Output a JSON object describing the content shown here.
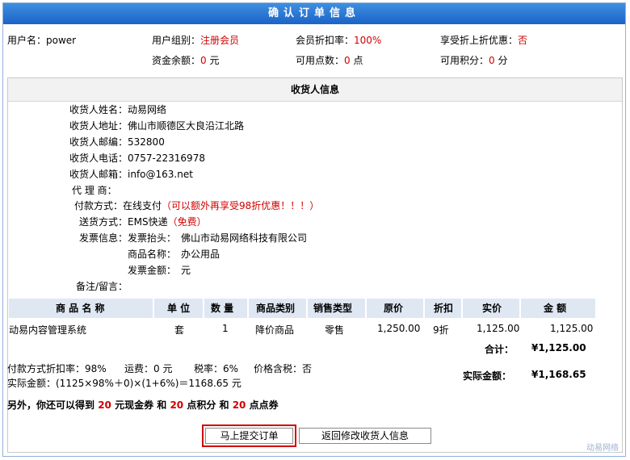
{
  "title": "确认订单信息",
  "account": {
    "username_label": "用户名：",
    "username": "power",
    "group_label": "用户组别：",
    "group": "注册会员",
    "discount_label": "会员折扣率：",
    "discount": "100%",
    "enjoy_label": "享受折上折优惠：",
    "enjoy": "否",
    "balance_label": "资金余额：",
    "balance": "0",
    "balance_unit": " 元",
    "points_label": "可用点数：",
    "points": "0",
    "points_unit": " 点",
    "score_label": "可用积分：",
    "score": "0",
    "score_unit": " 分"
  },
  "receiver": {
    "header": "收货人信息",
    "name_label": "收货人姓名：",
    "name": "动易网络",
    "address_label": "收货人地址：",
    "address": "佛山市顺德区大良沿江北路",
    "zip_label": "收货人邮编：",
    "zip": "532800",
    "phone_label": "收货人电话：",
    "phone": "0757-22316978",
    "email_label": "收货人邮箱：",
    "email": "info@163.net",
    "agent_label": "代 理 商：",
    "agent": "",
    "pay_label": "付款方式：",
    "pay": "在线支付",
    "pay_note": "（可以额外再享受98折优惠！！！）",
    "ship_label": "送货方式：",
    "ship": "EMS快递",
    "ship_note": "（免费）",
    "invoice_label": "发票信息：",
    "invoice_title_label": "发票抬头：",
    "invoice_title": "佛山市动易网络科技有限公司",
    "goods_name_label": "商品名称：",
    "goods_name": "办公用品",
    "invoice_amount_label": "发票金额：",
    "invoice_amount": "元",
    "remark_label": "备注/留言："
  },
  "table": {
    "headers": [
      "商 品 名 称",
      "单 位",
      "数 量",
      "商品类别",
      "销售类型",
      "原价",
      "折扣",
      "实价",
      "金 额"
    ],
    "row": [
      "动易内容管理系统",
      "套",
      "1",
      "降价商品",
      "零售",
      "1,250.00",
      "9折",
      "1,125.00",
      "1,125.00"
    ]
  },
  "totals": {
    "subtotal_label": "合计：",
    "subtotal": "¥1,125.00",
    "pay_rate_label": "付款方式折扣率：",
    "pay_rate": "98%",
    "freight_label": "运费：",
    "freight": "0 元",
    "tax_label": "税率：",
    "tax": "6%",
    "tax_incl_label": "价格含税：",
    "tax_incl": "否",
    "formula": "实际金额：(1125×98%＋0)×(1+6%)＝1168.65 元",
    "actual_label": "实际金额：",
    "actual": "¥1,168.65"
  },
  "bonus": {
    "t1": "另外，你还可以得到 ",
    "v1": "20",
    "t2": " 元现金券 和 ",
    "v2": "20",
    "t3": " 点积分 和 ",
    "v3": "20",
    "t4": " 点点券"
  },
  "buttons": {
    "submit": "马上提交订单",
    "back": "返回修改收货人信息"
  },
  "watermark": "动易网络"
}
